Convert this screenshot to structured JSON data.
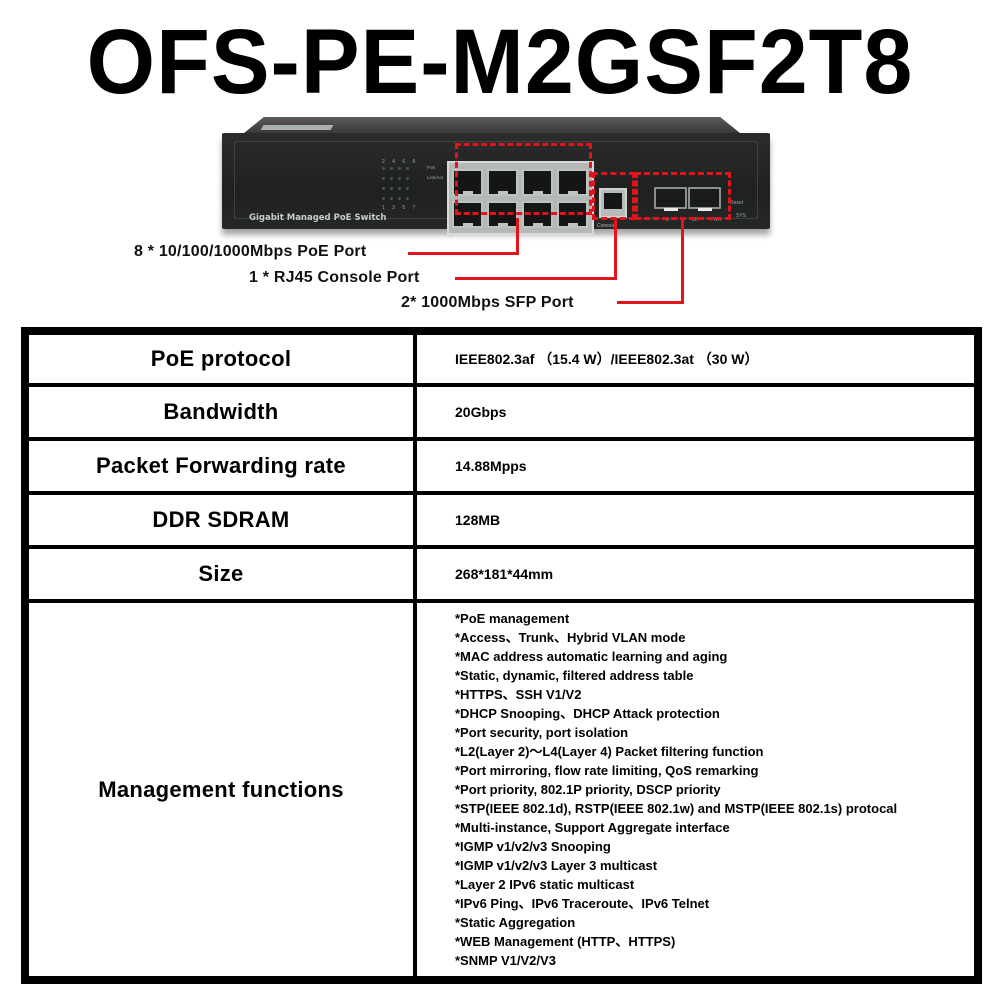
{
  "title": "OFS-PE-M2GSF2T8",
  "device": {
    "front_label": "Gigabit Managed PoE Switch",
    "led_top_numbers": "2 4 6 8",
    "led_bottom_numbers": "1 3 5 7",
    "led_labels": [
      "PoE",
      "Link/Act"
    ],
    "port_top_numbers": [
      "2",
      "4",
      "6",
      "8"
    ],
    "port_bottom_numbers": [
      "1",
      "3",
      "5",
      "7"
    ],
    "console_label": "Console",
    "sfp_labels": [
      "9",
      "10"
    ],
    "pwr_label": "PWR",
    "reset_label": "Reset",
    "sys_label": "SYS",
    "highlight_color": "#e0141a"
  },
  "callouts": [
    {
      "text": "8 * 10/100/1000Mbps PoE Port"
    },
    {
      "text": "1 * RJ45 Console Port"
    },
    {
      "text": "2* 1000Mbps SFP Port"
    }
  ],
  "specs": [
    {
      "label": "PoE protocol",
      "value": "IEEE802.3af （15.4 W）/IEEE802.3at （30 W）"
    },
    {
      "label": "Bandwidth",
      "value": "20Gbps"
    },
    {
      "label": "Packet Forwarding rate",
      "value": "14.88Mpps"
    },
    {
      "label": "DDR SDRAM",
      "value": "128MB"
    },
    {
      "label": "Size",
      "value": "268*181*44mm"
    }
  ],
  "management": {
    "label": "Management functions",
    "items": [
      "*PoE management",
      "*Access、Trunk、Hybrid VLAN mode",
      "*MAC address automatic learning and aging",
      "*Static, dynamic, filtered address table",
      "*HTTPS、SSH V1/V2",
      "*DHCP Snooping、DHCP Attack protection",
      "*Port security, port isolation",
      "*L2(Layer 2)～L4(Layer 4) Packet filtering function",
      "*Port mirroring, flow rate limiting, QoS remarking",
      "*Port priority, 802.1P priority, DSCP priority",
      "*STP(IEEE 802.1d), RSTP(IEEE 802.1w) and MSTP(IEEE 802.1s) protocal",
      "*Multi-instance, Support Aggregate interface",
      "*IGMP v1/v2/v3 Snooping",
      "*IGMP v1/v2/v3 Layer 3 multicast",
      "*Layer 2 IPv6 static multicast",
      "*IPv6 Ping、IPv6 Traceroute、IPv6 Telnet",
      "*Static Aggregation",
      "*WEB Management (HTTP、HTTPS)",
      "*SNMP V1/V2/V3"
    ]
  }
}
